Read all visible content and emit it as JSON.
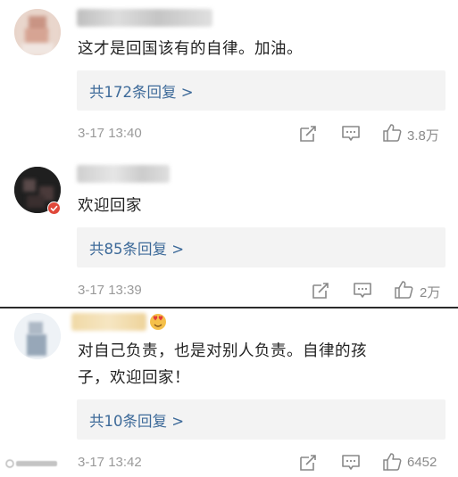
{
  "comments": [
    {
      "text": "这才是回国该有的自律。加油。",
      "replies": "共172条回复 >",
      "time": "3-17 13:40",
      "likes": "3.8万"
    },
    {
      "text": "欢迎回家",
      "replies": "共85条回复 >",
      "time": "3-17 13:39",
      "likes": "2万"
    },
    {
      "text_line1": "对自己负责，也是对别人负责。自律的孩",
      "text_line2": "子，欢迎回家！",
      "replies": "共10条回复 >",
      "time": "3-17 13:42",
      "likes": "6452"
    }
  ],
  "icons": {
    "share": "share-icon",
    "comment": "comment-icon",
    "like": "thumbs-up-icon",
    "badge": "emoji-badge-icon",
    "verified": "verified-badge-icon"
  },
  "colors": {
    "reply_link": "#3d6a99",
    "reply_box_bg": "#f3f3f3",
    "meta_text": "#9a9a9a"
  }
}
